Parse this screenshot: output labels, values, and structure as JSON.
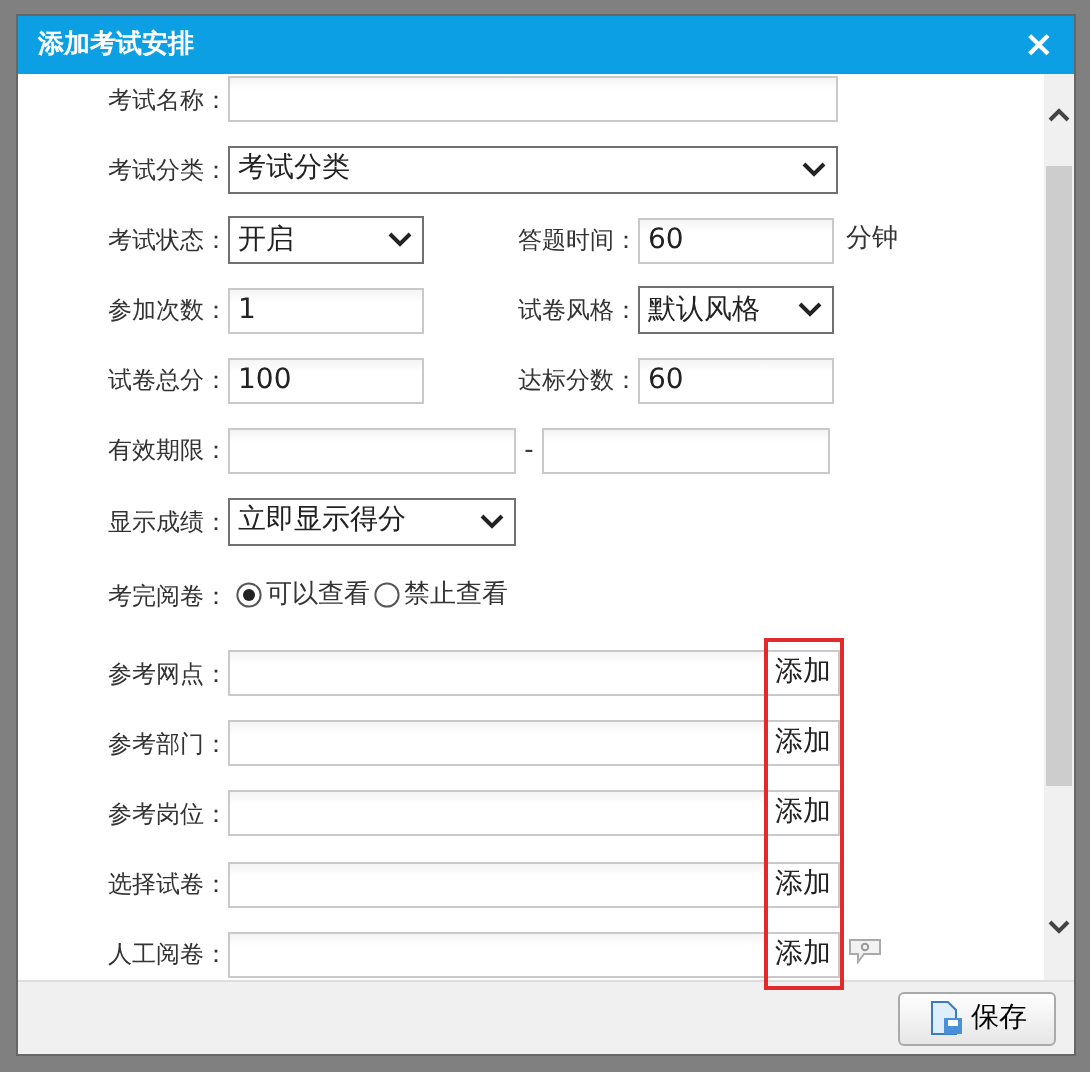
{
  "dialog": {
    "title": "添加考试安排",
    "close": "×"
  },
  "rows": [
    {
      "fields": [
        {
          "kind": "long-input",
          "label": "考试名称："
        }
      ]
    },
    {
      "fields": [
        {
          "kind": "long-select",
          "label": "考试分类：",
          "value": "考试分类"
        }
      ]
    },
    {
      "fields": [
        {
          "kind": "short-select",
          "label": "考试状态：",
          "value": "开启"
        },
        {
          "kind": "short-input",
          "label": "答题时间：",
          "value": "60",
          "unit": "分钟"
        }
      ]
    },
    {
      "fields": [
        {
          "kind": "short-input",
          "label": "参加次数：",
          "value": "1"
        },
        {
          "kind": "short-select",
          "label": "试卷风格：",
          "value": "默认风格"
        }
      ]
    },
    {
      "fields": [
        {
          "kind": "short-input",
          "label": "试卷总分：",
          "value": "100"
        },
        {
          "kind": "short-input",
          "label": "达标分数：",
          "value": "60"
        }
      ]
    },
    {
      "fields": [
        {
          "kind": "date-range",
          "label": "有效期限：",
          "separator": "-"
        }
      ]
    },
    {
      "fields": [
        {
          "kind": "medium-select",
          "label": "显示成绩：",
          "value": "立即显示得分"
        }
      ]
    },
    {
      "fields": [
        {
          "kind": "radio",
          "label": "考完阅卷：",
          "options": [
            {
              "label": "可以查看",
              "selected": true
            },
            {
              "label": "禁止查看",
              "selected": false
            }
          ]
        }
      ]
    },
    {
      "fields": [
        {
          "kind": "picker",
          "label": "参考网点：",
          "button": "添加",
          "help": false
        }
      ]
    },
    {
      "fields": [
        {
          "kind": "picker",
          "label": "参考部门：",
          "button": "添加",
          "help": false
        }
      ]
    },
    {
      "fields": [
        {
          "kind": "picker",
          "label": "参考岗位：",
          "button": "添加",
          "help": false
        }
      ]
    },
    {
      "fields": [
        {
          "kind": "picker",
          "label": "选择试卷：",
          "button": "添加",
          "help": false
        }
      ]
    },
    {
      "fields": [
        {
          "kind": "picker",
          "label": "人工阅卷：",
          "button": "添加",
          "help": true
        }
      ]
    }
  ],
  "highlight_add_buttons": true,
  "footer": {
    "save_button": "保存"
  }
}
